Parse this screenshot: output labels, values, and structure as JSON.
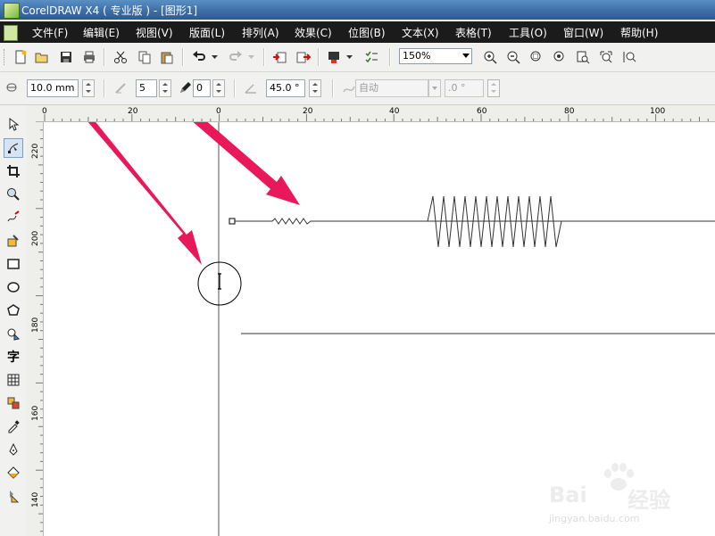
{
  "window": {
    "title": "CorelDRAW X4 ( 专业版 ) - [图形1]"
  },
  "menu": {
    "items": [
      {
        "label": "文件(F)"
      },
      {
        "label": "编辑(E)"
      },
      {
        "label": "视图(V)"
      },
      {
        "label": "版面(L)"
      },
      {
        "label": "排列(A)"
      },
      {
        "label": "效果(C)"
      },
      {
        "label": "位图(B)"
      },
      {
        "label": "文本(X)"
      },
      {
        "label": "表格(T)"
      },
      {
        "label": "工具(O)"
      },
      {
        "label": "窗口(W)"
      },
      {
        "label": "帮助(H)"
      }
    ]
  },
  "toolbar": {
    "zoom_value": "150%"
  },
  "property_bar": {
    "size_value": "10.0 mm",
    "count_value": "5",
    "outline_value": "0",
    "angle_value": "45.0 °",
    "auto_value": "自动",
    "degree_value": ".0 °"
  },
  "ruler": {
    "h_labels": [
      "0",
      "20",
      "0",
      "20",
      "40",
      "60",
      "80",
      "100"
    ],
    "v_labels": [
      "220",
      "200",
      "180",
      "160",
      "140"
    ]
  },
  "toolbox": {
    "text_tool_glyph": "字"
  },
  "watermark": {
    "brand": "Bai",
    "brand_suffix": "经验",
    "url": "jingyan.baidu.com"
  },
  "colors": {
    "arrow": "#e8185a",
    "titlebar": "#3d6fa6",
    "menubar": "#1b1b1b",
    "active_tool": "#d5e3f2"
  },
  "icons": {
    "new": "new-document-icon",
    "open": "open-folder-icon",
    "save": "save-icon",
    "print": "print-icon",
    "cut": "cut-icon",
    "copy": "copy-icon",
    "paste": "paste-icon",
    "undo": "undo-icon",
    "redo": "redo-icon",
    "import": "import-icon",
    "export": "export-icon",
    "publish": "publish-icon",
    "launcher": "launcher-icon",
    "zoom_in": "zoom-in-icon",
    "zoom_out": "zoom-out-icon"
  }
}
